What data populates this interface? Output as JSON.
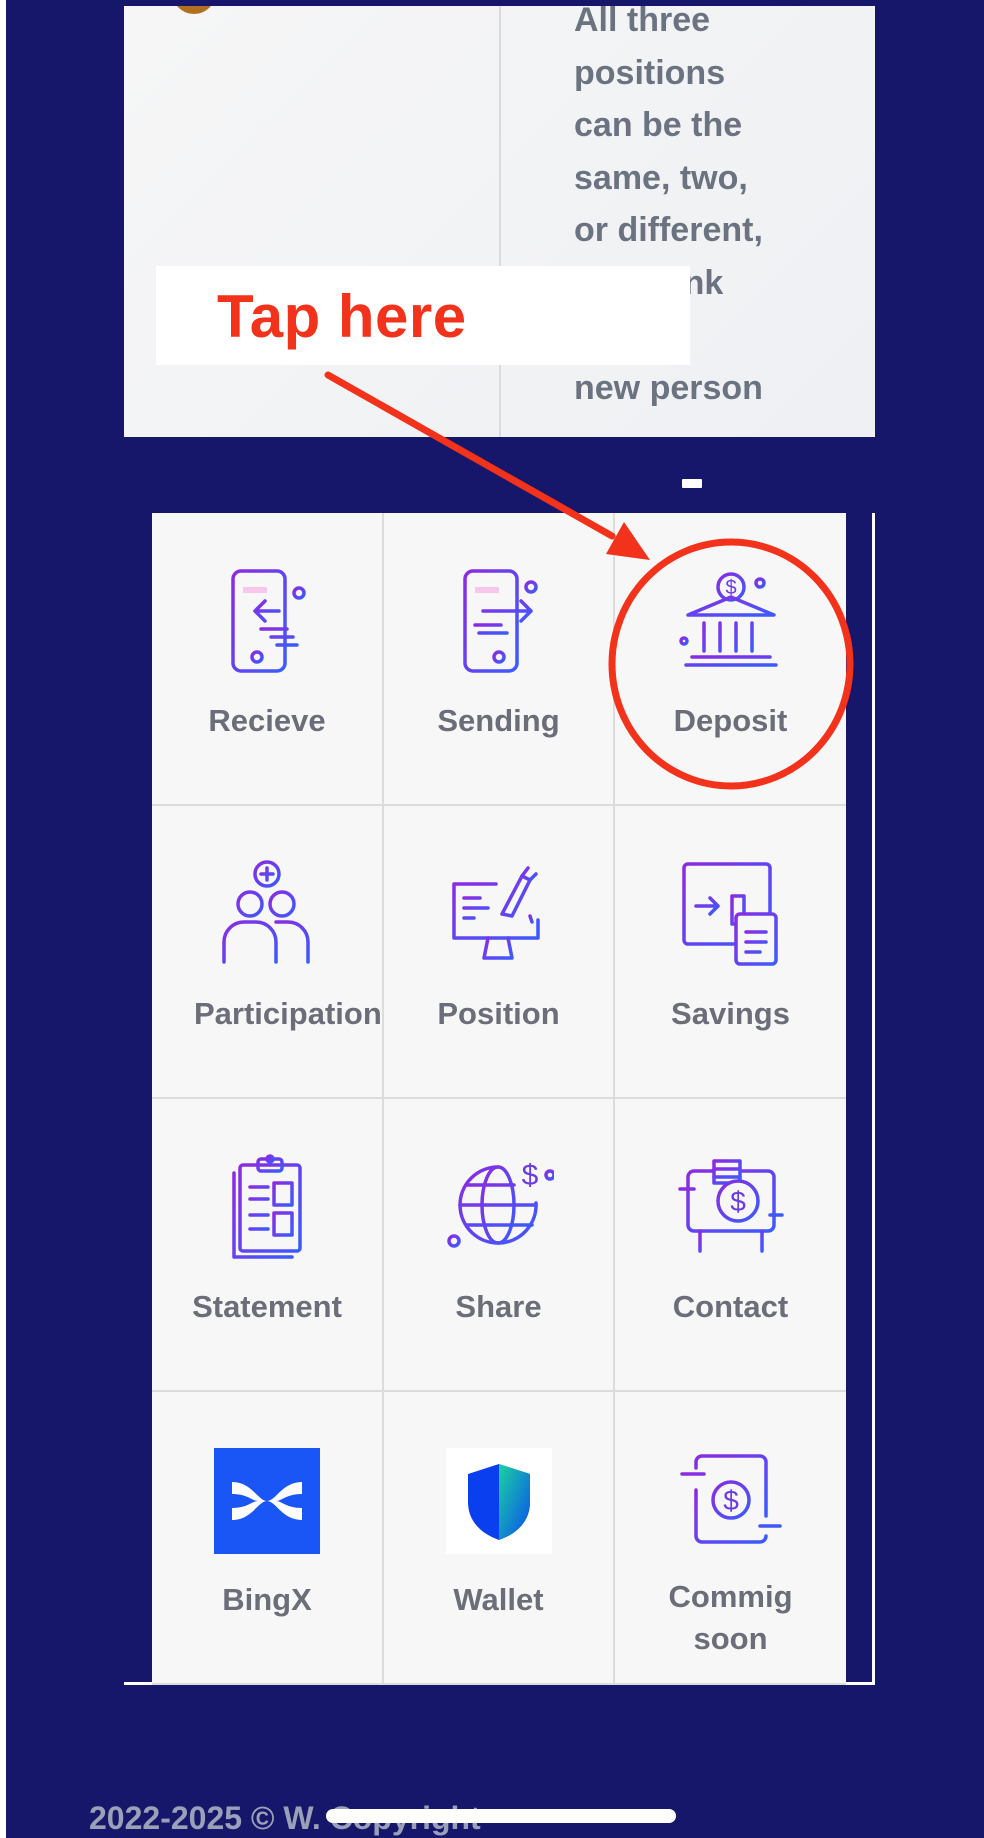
{
  "info_card": {
    "text": "All three\npositions\ncan be the\nsame, two,\nor different,\nThe bank\nwill the\nnew person"
  },
  "annotation": {
    "label": "Tap here",
    "color": "#f2321a"
  },
  "grid": {
    "items": [
      {
        "label": "Recieve",
        "icon": "phone-receive-icon"
      },
      {
        "label": "Sending",
        "icon": "phone-send-icon"
      },
      {
        "label": "Deposit",
        "icon": "bank-dollar-icon"
      },
      {
        "label": "Participation",
        "icon": "users-plus-icon"
      },
      {
        "label": "Position",
        "icon": "monitor-hand-icon"
      },
      {
        "label": "Savings",
        "icon": "transfer-document-icon"
      },
      {
        "label": "Statement",
        "icon": "clipboard-icon"
      },
      {
        "label": "Share",
        "icon": "globe-dollar-icon"
      },
      {
        "label": "Contact",
        "icon": "cash-register-icon"
      },
      {
        "label": "BingX",
        "icon": "bingx-logo"
      },
      {
        "label": "Wallet",
        "icon": "shield-wallet-icon"
      },
      {
        "label": "Commig\nsoon",
        "icon": "dollar-frame-icon"
      }
    ]
  },
  "footer": {
    "text": "2022-2025 © W. Copyright"
  },
  "colors": {
    "background": "#16166a",
    "icon_gradient_start": "#8b2be2",
    "icon_gradient_end": "#3b5bff",
    "label": "#6b6e78"
  }
}
